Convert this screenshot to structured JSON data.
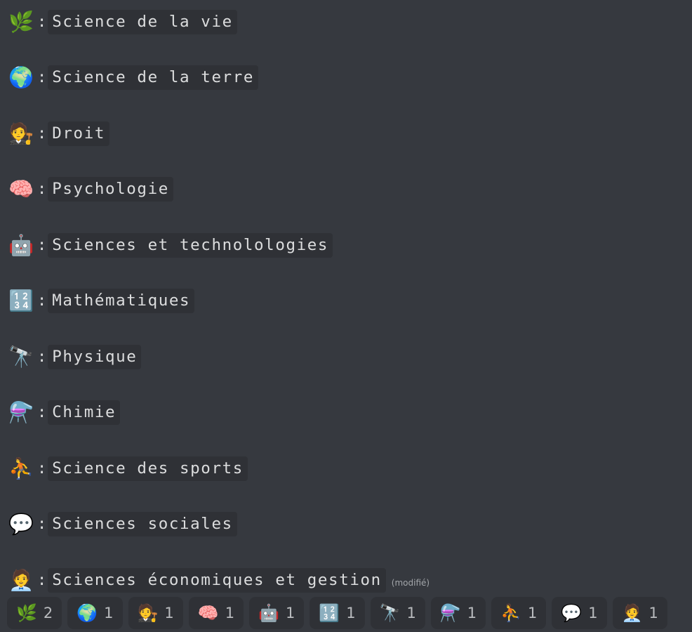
{
  "message": {
    "lines": [
      {
        "emoji": "🌿",
        "icon": "herb-icon",
        "label": "Science de la vie"
      },
      {
        "emoji": "🌍",
        "icon": "globe-icon",
        "label": "Science de la terre"
      },
      {
        "emoji": "🧑‍⚖️",
        "icon": "judge-icon",
        "label": "Droit"
      },
      {
        "emoji": "🧠",
        "icon": "brain-icon",
        "label": "Psychologie"
      },
      {
        "emoji": "🤖",
        "icon": "robot-icon",
        "label": "Sciences et technolologies"
      },
      {
        "emoji": "🔢",
        "icon": "numbers-icon",
        "label": "Mathématiques"
      },
      {
        "emoji": "🔭",
        "icon": "telescope-icon",
        "label": "Physique"
      },
      {
        "emoji": "⚗️",
        "icon": "alembic-icon",
        "label": "Chimie"
      },
      {
        "emoji": "⛹️",
        "icon": "basketball-player-icon",
        "label": "Science des sports"
      },
      {
        "emoji": "💬",
        "icon": "speech-bubble-icon",
        "label": "Sciences sociales"
      },
      {
        "emoji": "🧑‍💼",
        "icon": "office-worker-icon",
        "label": "Sciences économiques et gestion"
      }
    ],
    "colon": ":",
    "edited_label": "(modifié)"
  },
  "reactions": [
    {
      "emoji": "🌿",
      "icon": "herb-icon",
      "count": "2"
    },
    {
      "emoji": "🌍",
      "icon": "globe-icon",
      "count": "1"
    },
    {
      "emoji": "🧑‍⚖️",
      "icon": "judge-icon",
      "count": "1"
    },
    {
      "emoji": "🧠",
      "icon": "brain-icon",
      "count": "1"
    },
    {
      "emoji": "🤖",
      "icon": "robot-icon",
      "count": "1"
    },
    {
      "emoji": "🔢",
      "icon": "numbers-icon",
      "count": "1"
    },
    {
      "emoji": "🔭",
      "icon": "telescope-icon",
      "count": "1"
    },
    {
      "emoji": "⚗️",
      "icon": "alembic-icon",
      "count": "1"
    },
    {
      "emoji": "⛹️",
      "icon": "basketball-player-icon",
      "count": "1"
    },
    {
      "emoji": "💬",
      "icon": "speech-bubble-icon",
      "count": "1"
    },
    {
      "emoji": "🧑‍💼",
      "icon": "office-worker-icon",
      "count": "1"
    }
  ],
  "colors": {
    "background": "#36393f",
    "code_background": "#2f3136",
    "text": "#dcddde",
    "muted": "#a3a6aa"
  }
}
